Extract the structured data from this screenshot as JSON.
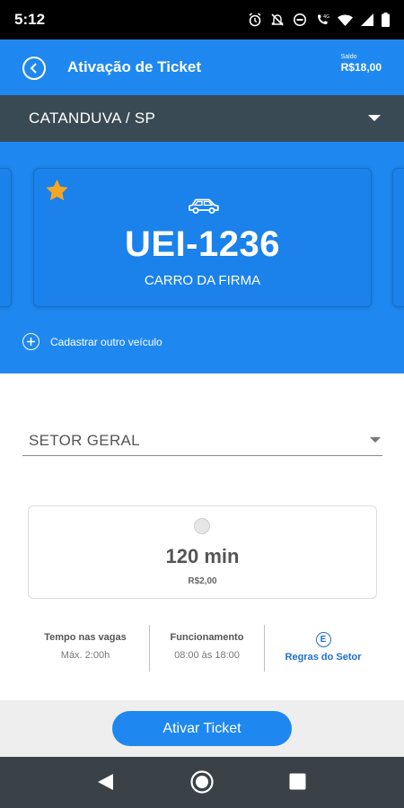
{
  "status_bar": {
    "time": "5:12",
    "icons": [
      "alarm-icon",
      "notifications-off-icon",
      "do-not-disturb-icon",
      "wifi-calling-icon",
      "wifi-icon",
      "signal-icon",
      "battery-icon"
    ]
  },
  "header": {
    "title": "Ativação de Ticket",
    "balance_label": "Saldo",
    "balance_value": "R$18,00",
    "back_icon": "back-icon"
  },
  "city": {
    "selected": "CATANDUVA / SP"
  },
  "vehicle": {
    "plate": "UEI-1236",
    "description": "CARRO DA FIRMA",
    "favorite_icon": "star-icon",
    "type_icon": "car-icon",
    "add_label": "Cadastrar outro veículo"
  },
  "sector": {
    "selected": "SETOR GERAL"
  },
  "time_option": {
    "duration": "120 min",
    "price": "R$2,00"
  },
  "info": {
    "parking_time_title": "Tempo nas vagas",
    "parking_time_value": "Máx. 2:00h",
    "hours_title": "Funcionamento",
    "hours_value": "08:00 às 18:00",
    "rules_icon_letter": "E",
    "rules_label": "Regras do Setor"
  },
  "actions": {
    "activate_label": "Ativar Ticket"
  },
  "colors": {
    "primary": "#1e88f0",
    "city_bar": "#3a4a55",
    "star": "#f5a623",
    "link": "#1e70d0",
    "nav_bar": "#3a4248"
  }
}
